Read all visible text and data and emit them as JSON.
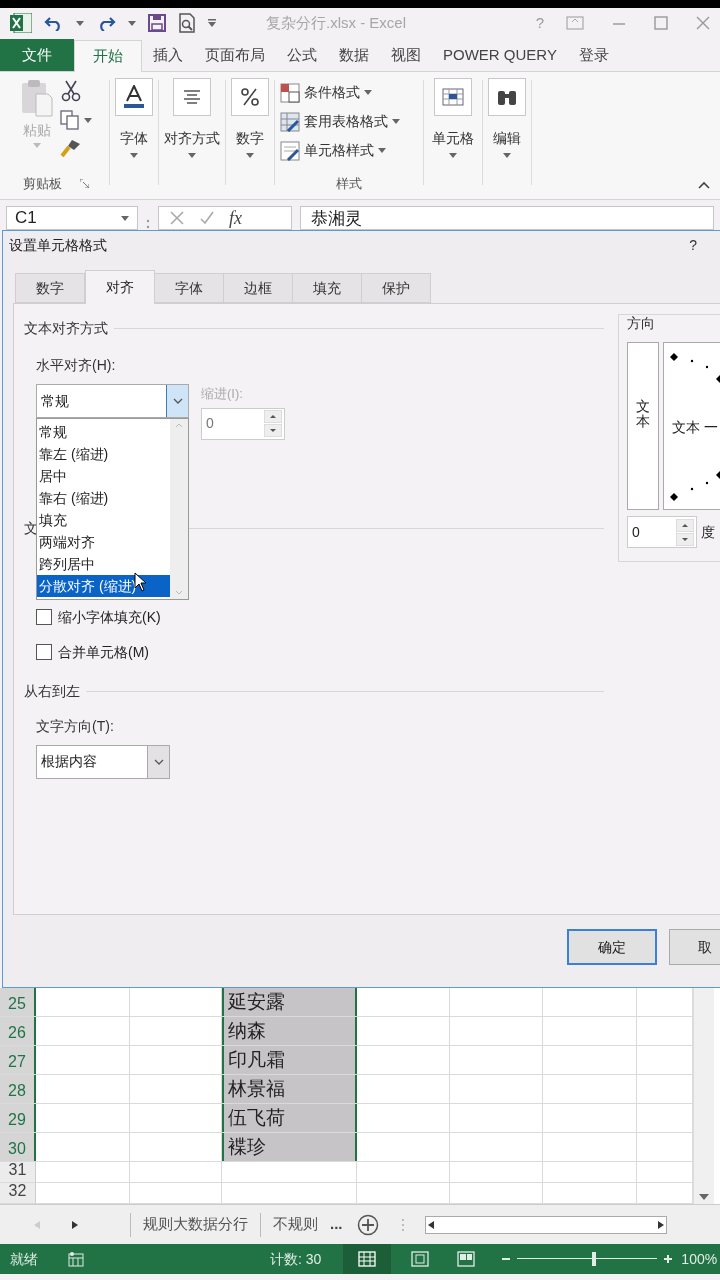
{
  "title_bar": {
    "title": "复杂分行.xlsx - Excel",
    "help": "?"
  },
  "ribbon_tabs": [
    {
      "label": "文件",
      "kind": "file",
      "selected": false
    },
    {
      "label": "开始",
      "kind": "tab",
      "selected": true
    },
    {
      "label": "插入",
      "kind": "tab",
      "selected": false
    },
    {
      "label": "页面布局",
      "kind": "tab",
      "selected": false
    },
    {
      "label": "公式",
      "kind": "tab",
      "selected": false
    },
    {
      "label": "数据",
      "kind": "tab",
      "selected": false
    },
    {
      "label": "视图",
      "kind": "tab",
      "selected": false
    },
    {
      "label": "POWER QUERY",
      "kind": "tab",
      "selected": false
    },
    {
      "label": "登录",
      "kind": "tab",
      "selected": false
    }
  ],
  "ribbon": {
    "paste": "粘贴",
    "clipboard_group": "剪贴板",
    "font": "字体",
    "alignment": "对齐方式",
    "number": "数字",
    "styles": [
      "条件格式",
      "套用表格格式",
      "单元格样式"
    ],
    "styles_group": "样式",
    "cells": "单元格",
    "editing": "编辑"
  },
  "formula_bar": {
    "name_box": "C1",
    "fx": "fx",
    "value": "恭湘灵"
  },
  "dialog": {
    "title": "设置单元格格式",
    "help": "?",
    "tabs": [
      {
        "label": "数字",
        "selected": false
      },
      {
        "label": "对齐",
        "selected": true
      },
      {
        "label": "字体",
        "selected": false
      },
      {
        "label": "边框",
        "selected": false
      },
      {
        "label": "填充",
        "selected": false
      },
      {
        "label": "保护",
        "selected": false
      }
    ],
    "alignment_section": "文本对齐方式",
    "horizontal_label": "水平对齐(H):",
    "horizontal_value": "常规",
    "horizontal_options": [
      {
        "label": "常规",
        "selected": false
      },
      {
        "label": "靠左 (缩进)",
        "selected": false
      },
      {
        "label": "居中",
        "selected": false
      },
      {
        "label": "靠右 (缩进)",
        "selected": false
      },
      {
        "label": "填充",
        "selected": false
      },
      {
        "label": "两端对齐",
        "selected": false
      },
      {
        "label": "跨列居中",
        "selected": false
      },
      {
        "label": "分散对齐 (缩进)",
        "selected": true
      }
    ],
    "indent_label": "缩进(I):",
    "indent_value": "0",
    "indent_disabled": true,
    "text_control_section": "文",
    "checkboxes": [
      {
        "label": "缩小字体填充(K)",
        "checked": false
      },
      {
        "label": "合并单元格(M)",
        "checked": false
      }
    ],
    "rtl_section": "从右到左",
    "direction_label": "文字方向(T):",
    "direction_value": "根据内容",
    "orientation": {
      "title": "方向",
      "vertical_text": "文本",
      "dial_text": "文本 一",
      "degrees": "0",
      "degrees_unit": "度"
    },
    "buttons": [
      {
        "label": "确定",
        "default": true
      },
      {
        "label": "取",
        "default": false
      }
    ]
  },
  "sheet": {
    "rows": [
      {
        "number": "25",
        "name": "延安露",
        "selected": true
      },
      {
        "number": "26",
        "name": "纳森",
        "selected": true
      },
      {
        "number": "27",
        "name": "印凡霜",
        "selected": true
      },
      {
        "number": "28",
        "name": "林景福",
        "selected": true
      },
      {
        "number": "29",
        "name": "伍飞荷",
        "selected": true
      },
      {
        "number": "30",
        "name": "褋珍",
        "selected": true
      },
      {
        "number": "31",
        "name": "",
        "selected": false
      },
      {
        "number": "32",
        "name": "",
        "selected": false
      }
    ],
    "tabs": [
      {
        "label": "规则大数据分行"
      },
      {
        "label": "不规则"
      }
    ],
    "more": "..."
  },
  "status_bar": {
    "ready": "就绪",
    "count": "计数: 30",
    "zoom": "100%",
    "zoom_slider": {
      "level": 0.55
    }
  }
}
